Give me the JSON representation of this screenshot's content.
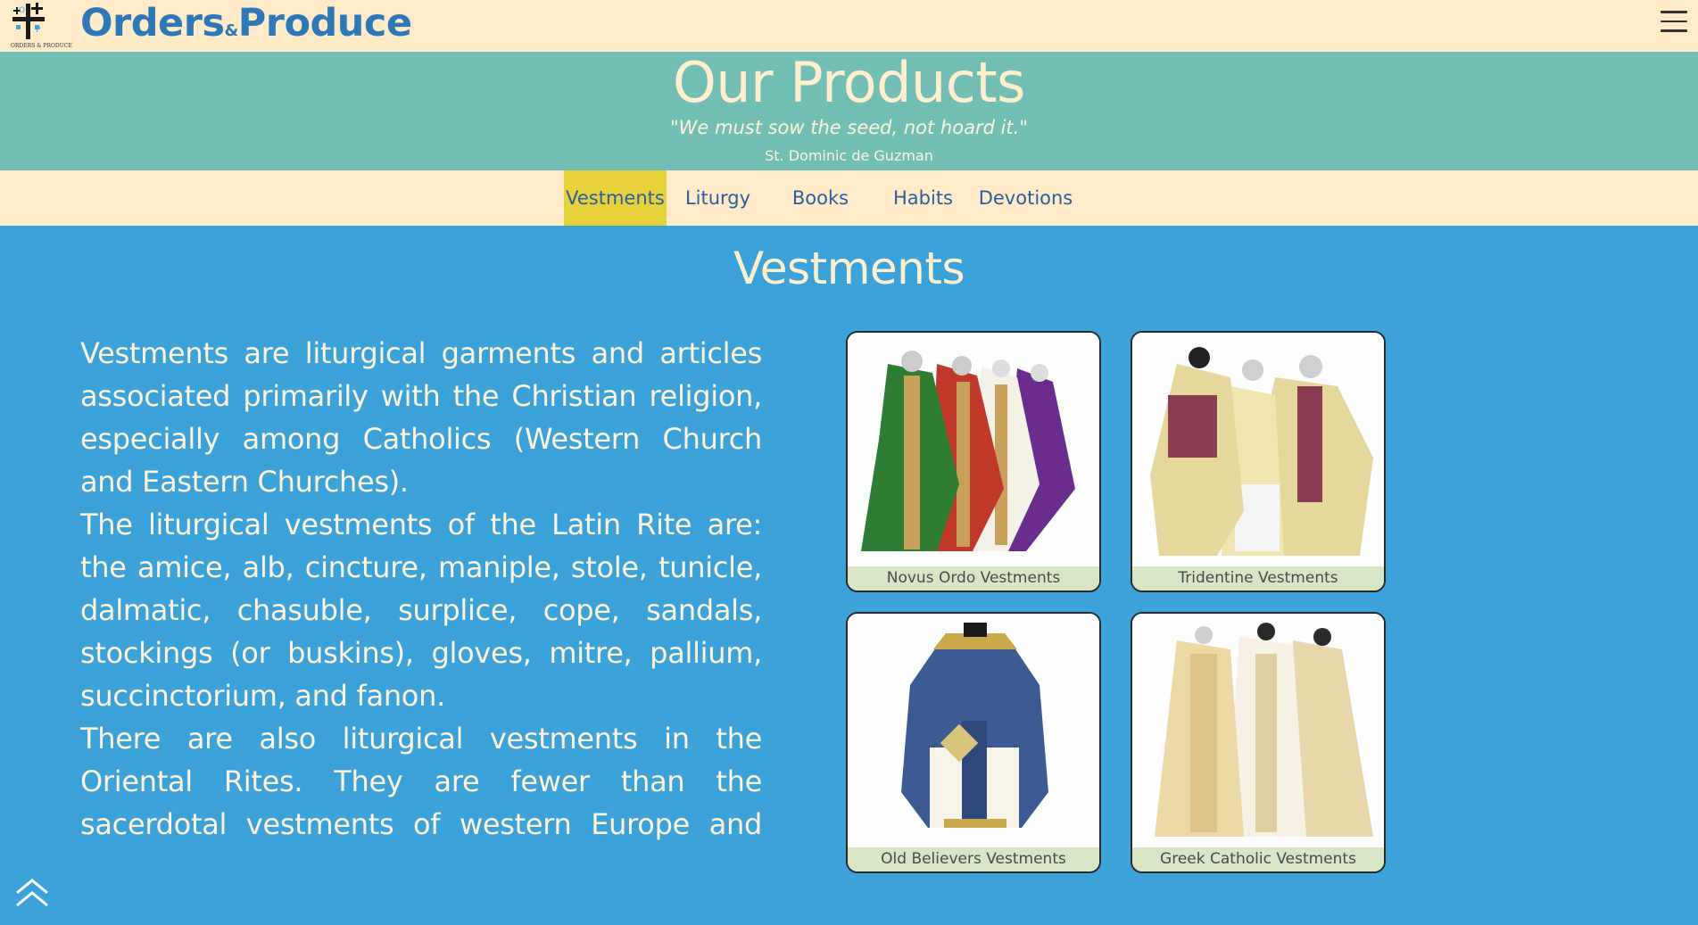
{
  "header": {
    "logo_caption": "ORDERS & PRODUCE",
    "brand_left": "Orders",
    "brand_amp": "&",
    "brand_right": "Produce",
    "menu_icon": "hamburger-menu-icon"
  },
  "hero": {
    "title": "Our Products",
    "quote": "\"We must sow the seed, not hoard it.\"",
    "author": "St. Dominic de Guzman"
  },
  "tabs": [
    {
      "label": "Vestments",
      "active": true
    },
    {
      "label": "Liturgy",
      "active": false
    },
    {
      "label": "Books",
      "active": false
    },
    {
      "label": "Habits",
      "active": false
    },
    {
      "label": "Devotions",
      "active": false
    }
  ],
  "section": {
    "title": "Vestments",
    "paragraphs": [
      "Vestments are liturgical garments and articles associated primarily with the Christian religion, especially among Catholics (Western Church and Eastern Churches).",
      "The liturgical vestments of the Latin Rite are: the amice, alb, cincture, maniple, stole, tunicle, dalmatic, chasuble, surplice, cope, sandals, stockings (or buskins), gloves, mitre, pallium, succinctorium, and fanon.",
      "There are also liturgical vestments in the Oriental Rites. They are fewer than the sacerdotal vestments of western Europe and vary from these also as"
    ]
  },
  "cards": [
    {
      "caption": "Novus Ordo Vestments"
    },
    {
      "caption": "Tridentine Vestments"
    },
    {
      "caption": "Old Believers Vestments"
    },
    {
      "caption": "Greek Catholic Vestments"
    }
  ],
  "colors": {
    "topbar": "#ffebc8",
    "hero": "#73bfb6",
    "page": "#3ba3da",
    "brand": "#2e78b8",
    "active_tab": "#e8d23c"
  }
}
